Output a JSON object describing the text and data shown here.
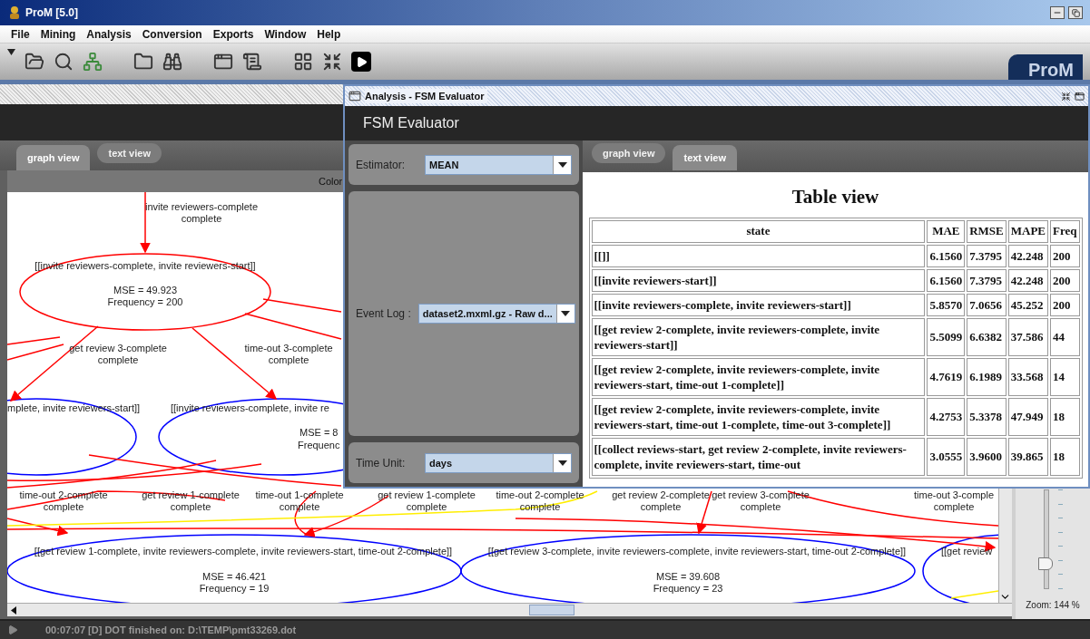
{
  "window": {
    "title": "ProM [5.0]"
  },
  "menu": [
    "File",
    "Mining",
    "Analysis",
    "Conversion",
    "Exports",
    "Window",
    "Help"
  ],
  "toolbar": {
    "logo": "ProM"
  },
  "main_frame": {
    "tabs": [
      {
        "label": "graph view",
        "selected": true
      },
      {
        "label": "text view",
        "selected": false
      }
    ],
    "legend_label": "Color",
    "graph": {
      "nodes": [
        {
          "state": "[[invite reviewers-complete, invite reviewers-start]]",
          "mse": "MSE = 49.923",
          "frequency": "Frequency = 200",
          "color": "#ff0000"
        },
        {
          "state": "mplete, invite reviewers-start]]",
          "color": "#0000ff"
        },
        {
          "state": "[[invite reviewers-complete, invite re",
          "mse": "MSE = 8",
          "frequency": "Frequenc",
          "color": "#0000ff"
        },
        {
          "state": "[[get review 1-complete, invite reviewers-complete, invite reviewers-start, time-out 2-complete]]",
          "mse": "MSE = 46.421",
          "frequency": "Frequency = 19",
          "color": "#0000ff"
        },
        {
          "state": "[[get review 3-complete, invite reviewers-complete, invite reviewers-start, time-out 2-complete]]",
          "mse": "MSE = 39.608",
          "frequency": "Frequency = 23",
          "color": "#0000ff"
        },
        {
          "state": "[[get review",
          "color": "#0000ff"
        }
      ],
      "edge_labels": [
        {
          "event": "invite reviewers-complete",
          "type": "complete"
        },
        {
          "event": "get review 3-complete",
          "type": "complete"
        },
        {
          "event": "time-out 3-complete",
          "type": "complete"
        },
        {
          "event": "time-out 2-complete",
          "type": "complete"
        },
        {
          "event": "get review 1-complete",
          "type": "complete"
        },
        {
          "event": "time-out 1-complete",
          "type": "complete"
        },
        {
          "event": "get review 1-complete",
          "type": "complete"
        },
        {
          "event": "time-out 2-complete",
          "type": "complete"
        },
        {
          "event": "get review 2-complete",
          "type": "complete"
        },
        {
          "event": "get review 3-complete",
          "type": "complete"
        },
        {
          "event": "time-out 3-comple",
          "type": "complete"
        }
      ]
    },
    "zoom": {
      "level": 0.25,
      "reading": "Zoom: 144 %"
    }
  },
  "dialog": {
    "title": "Analysis - FSM Evaluator",
    "header": "FSM Evaluator",
    "settings": [
      {
        "label": "Estimator:",
        "value": "MEAN"
      },
      {
        "label": "Event Log :",
        "value": "dataset2.mxml.gz - Raw d..."
      },
      {
        "label": "Time Unit:",
        "value": "days"
      }
    ],
    "tabs": [
      {
        "label": "graph view",
        "selected": false
      },
      {
        "label": "text view",
        "selected": true
      }
    ],
    "table_title": "Table view",
    "table": {
      "columns": [
        "state",
        "MAE",
        "RMSE",
        "MAPE",
        "Freq"
      ],
      "rows": [
        [
          "[[]]",
          "6.1560",
          "7.3795",
          "42.248",
          "200"
        ],
        [
          "[[invite reviewers-start]]",
          "6.1560",
          "7.3795",
          "42.248",
          "200"
        ],
        [
          "[[invite reviewers-complete, invite reviewers-start]]",
          "5.8570",
          "7.0656",
          "45.252",
          "200"
        ],
        [
          "[[get review 2-complete, invite reviewers-complete, invite reviewers-start]]",
          "5.5099",
          "6.6382",
          "37.586",
          "44"
        ],
        [
          "[[get review 2-complete, invite reviewers-complete, invite reviewers-start, time-out 1-complete]]",
          "4.7619",
          "6.1989",
          "33.568",
          "14"
        ],
        [
          "[[get review 2-complete, invite reviewers-complete, invite reviewers-start, time-out 1-complete, time-out 3-complete]]",
          "4.2753",
          "5.3378",
          "47.949",
          "18"
        ],
        [
          "[[collect reviews-start, get review 2-complete, invite reviewers-complete, invite reviewers-start, time-out",
          "3.0555",
          "3.9600",
          "39.865",
          "18"
        ]
      ]
    }
  },
  "status_bar": "00:07:07 [D] DOT finished on: D:\\TEMP\\pmt33269.dot"
}
